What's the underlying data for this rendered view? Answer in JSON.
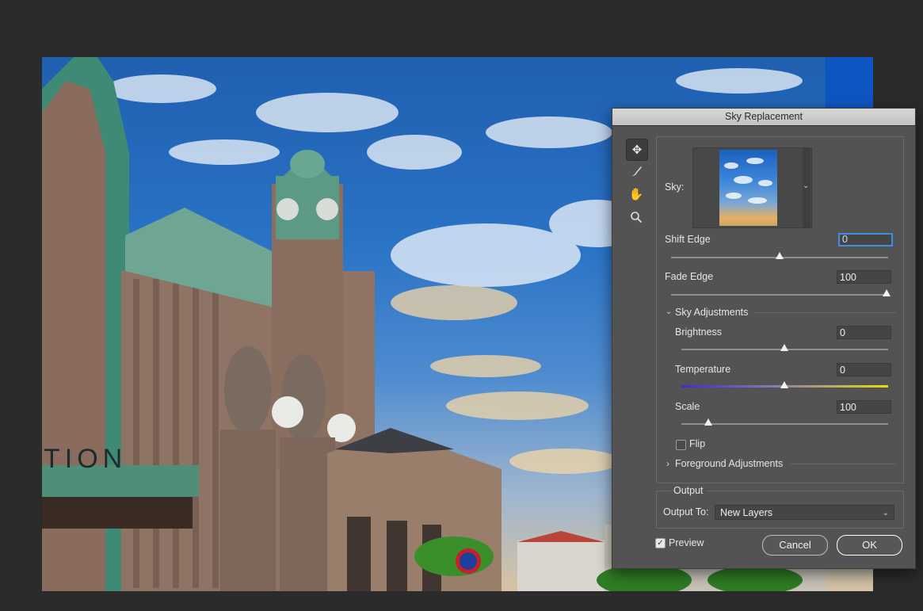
{
  "dialog": {
    "title": "Sky Replacement",
    "tools": [
      "move-tool-icon",
      "sky-brush-icon",
      "hand-icon",
      "zoom-icon"
    ],
    "sky_label": "Sky:",
    "shift_edge": {
      "label": "Shift Edge",
      "value": "0",
      "slider": 0.5
    },
    "fade_edge": {
      "label": "Fade Edge",
      "value": "100",
      "slider": 1.0
    },
    "sky_adjustments": {
      "label": "Sky Adjustments",
      "brightness": {
        "label": "Brightness",
        "value": "0",
        "slider": 0.5
      },
      "temperature": {
        "label": "Temperature",
        "value": "0",
        "slider": 0.5
      },
      "scale": {
        "label": "Scale",
        "value": "100",
        "slider": 0.13
      },
      "flip_label": "Flip",
      "flip_checked": false
    },
    "foreground_adjustments": {
      "label": "Foreground Adjustments"
    },
    "output": {
      "section_label": "Output",
      "output_to_label": "Output To:",
      "output_to_value": "New Layers"
    },
    "preview": {
      "label": "Preview",
      "checked": true
    },
    "buttons": {
      "cancel": "Cancel",
      "ok": "OK"
    }
  },
  "canvas": {
    "sign_text": "TION"
  },
  "colors": {
    "focus_ring": "#3f8de8",
    "temperature_cool": "#3a2bd8",
    "temperature_warm": "#e6e000",
    "dialog_bg": "#535353"
  }
}
